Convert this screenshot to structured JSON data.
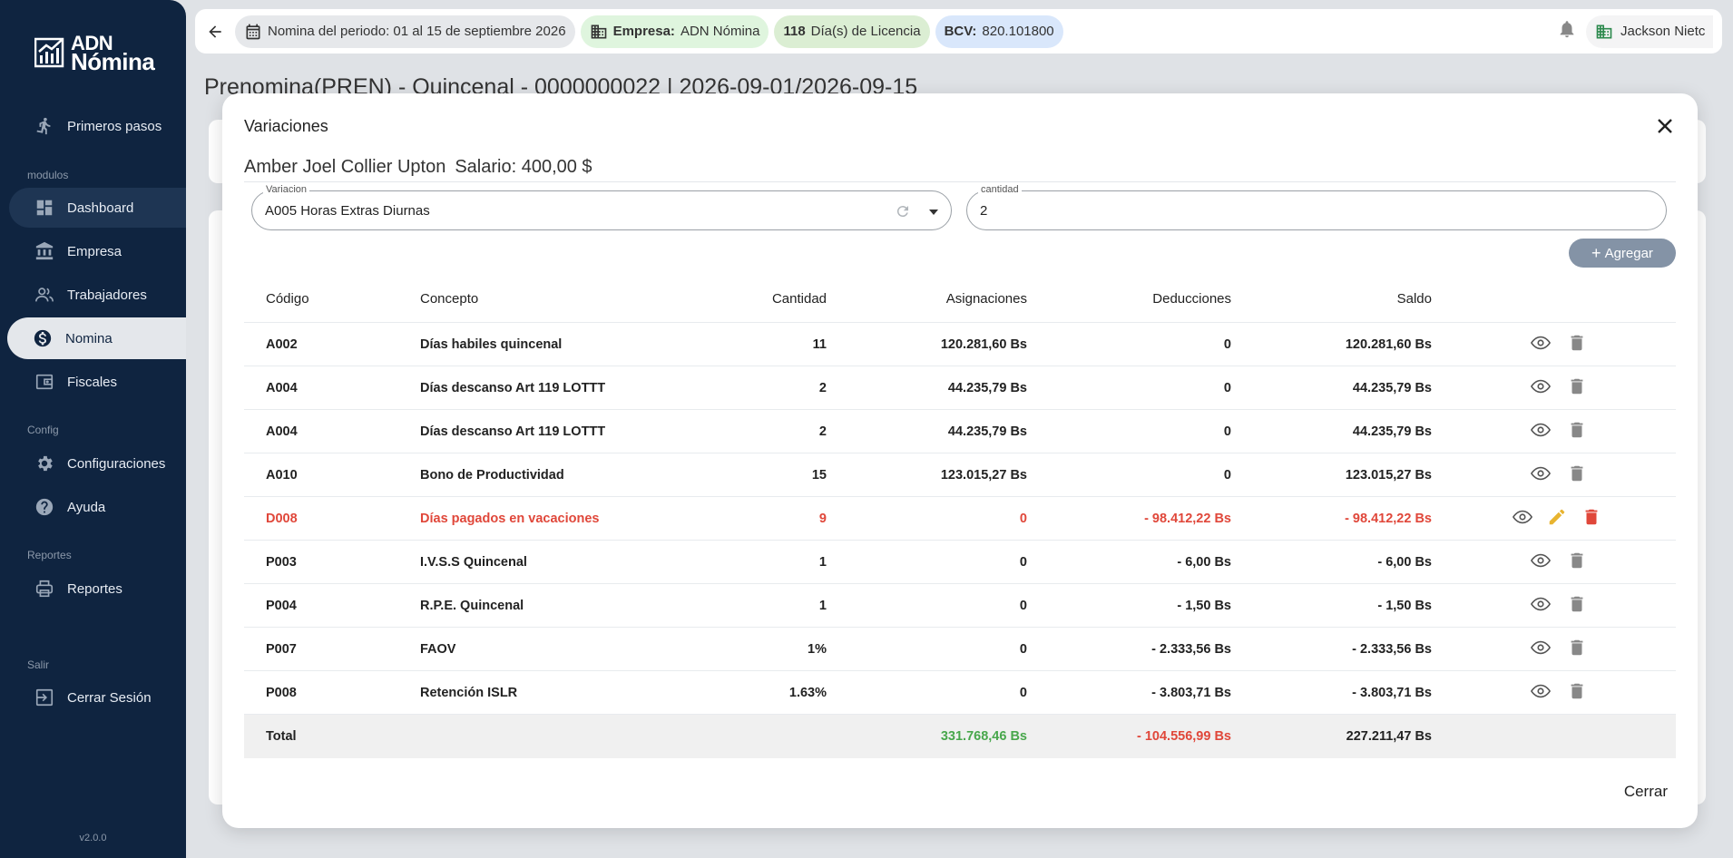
{
  "sidebar": {
    "logo_line1": "ADN",
    "logo_line2": "Nómina",
    "version": "v2.0.0",
    "items": {
      "primeros_pasos": "Primeros pasos",
      "dashboard": "Dashboard",
      "empresa": "Empresa",
      "trabajadores": "Trabajadores",
      "nomina": "Nomina",
      "fiscales": "Fiscales",
      "configuraciones": "Configuraciones",
      "ayuda": "Ayuda",
      "reportes": "Reportes",
      "cerrar_sesion": "Cerrar Sesión"
    },
    "sections": {
      "modulos": "modulos",
      "config": "Config",
      "reportes": "Reportes",
      "salir": "Salir"
    }
  },
  "topbar": {
    "period": "Nomina del periodo: 01 al 15 de septiembre 2026",
    "empresa_label": "Empresa:",
    "empresa_value": "ADN Nómina",
    "licencia_count": "118",
    "licencia_label": "Día(s) de Licencia",
    "bcv_label": "BCV:",
    "bcv_value": "820.101800",
    "user": "Jackson Nietc"
  },
  "page": {
    "title": "Prenomina(PREN) - Quincenal - 0000000022 | 2026-09-01/2026-09-15"
  },
  "modal": {
    "title": "Variaciones",
    "employee_name": "Amber Joel Collier Upton",
    "salary": "Salario: 400,00 $",
    "variacion_label": "Variacion",
    "variacion_value": "A005 Horas Extras Diurnas",
    "cantidad_label": "cantidad",
    "cantidad_value": "2",
    "add_button": "Agregar",
    "close_button": "Cerrar",
    "columns": {
      "codigo": "Código",
      "concepto": "Concepto",
      "cantidad": "Cantidad",
      "asignaciones": "Asignaciones",
      "deducciones": "Deducciones",
      "saldo": "Saldo"
    },
    "rows": [
      {
        "codigo": "A002",
        "concepto": "Días habiles quincenal",
        "cantidad": "11",
        "asignaciones": "120.281,60 Bs",
        "deducciones": "0",
        "saldo": "120.281,60 Bs"
      },
      {
        "codigo": "A004",
        "concepto": "Días descanso  Art 119 LOTTT",
        "cantidad": "2",
        "asignaciones": "44.235,79 Bs",
        "deducciones": "0",
        "saldo": "44.235,79 Bs"
      },
      {
        "codigo": "A004",
        "concepto": "Días descanso  Art 119 LOTTT",
        "cantidad": "2",
        "asignaciones": "44.235,79 Bs",
        "deducciones": "0",
        "saldo": "44.235,79 Bs"
      },
      {
        "codigo": "A010",
        "concepto": "Bono de Productividad",
        "cantidad": "15",
        "asignaciones": "123.015,27 Bs",
        "deducciones": "0",
        "saldo": "123.015,27 Bs"
      },
      {
        "codigo": "D008",
        "concepto": "Días pagados en vacaciones",
        "cantidad": "9",
        "asignaciones": "0",
        "deducciones": "- 98.412,22 Bs",
        "saldo": "- 98.412,22 Bs"
      },
      {
        "codigo": "P003",
        "concepto": "I.V.S.S Quincenal",
        "cantidad": "1",
        "asignaciones": "0",
        "deducciones": "- 6,00 Bs",
        "saldo": "- 6,00 Bs"
      },
      {
        "codigo": "P004",
        "concepto": "R.P.E. Quincenal",
        "cantidad": "1",
        "asignaciones": "0",
        "deducciones": "- 1,50 Bs",
        "saldo": "- 1,50 Bs"
      },
      {
        "codigo": "P007",
        "concepto": "FAOV",
        "cantidad": "1%",
        "asignaciones": "0",
        "deducciones": "- 2.333,56 Bs",
        "saldo": "- 2.333,56 Bs"
      },
      {
        "codigo": "P008",
        "concepto": "Retención ISLR",
        "cantidad": "1.63%",
        "asignaciones": "0",
        "deducciones": "- 3.803,71 Bs",
        "saldo": "- 3.803,71 Bs"
      }
    ],
    "total": {
      "label": "Total",
      "asignaciones": "331.768,46 Bs",
      "deducciones": "- 104.556,99 Bs",
      "saldo": "227.211,47 Bs"
    }
  },
  "colors": {
    "sidebar_bg": "#0f2440",
    "accent_red": "#e0473a",
    "accent_green": "#48a74c",
    "edit_yellow": "#e8b430",
    "add_button_bg": "#8493a6"
  }
}
